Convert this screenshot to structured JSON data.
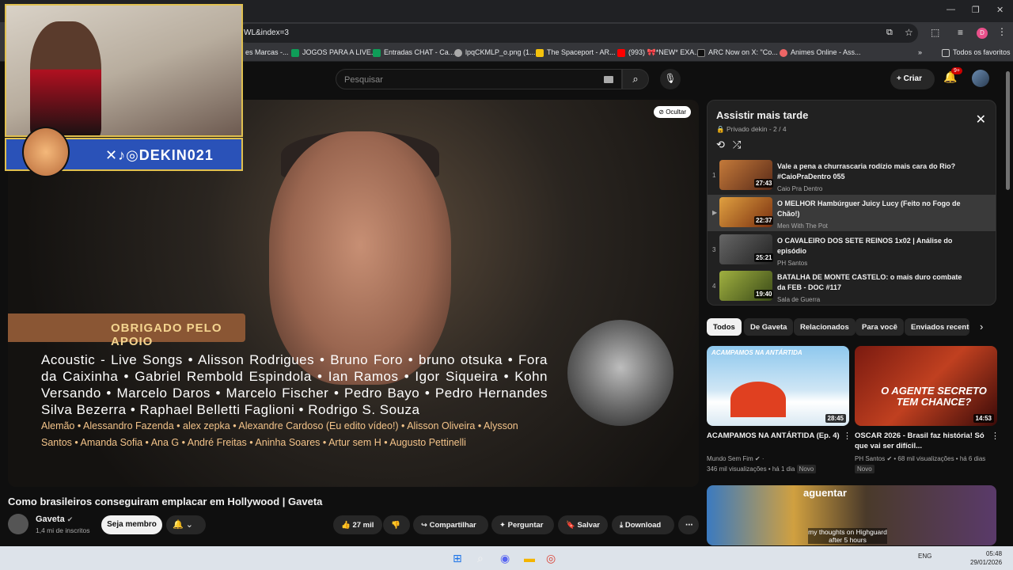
{
  "browser": {
    "url_fragment": "WL&index=3",
    "bookmarks": [
      {
        "label": "es Marcas -...",
        "color": "#888"
      },
      {
        "label": "JOGOS PARA A LIVE...",
        "color": "#0f9d58"
      },
      {
        "label": "Entradas CHAT - Ca...",
        "color": "#0f9d58"
      },
      {
        "label": "lpqCKMLP_o.png (1...",
        "color": "#aaa"
      },
      {
        "label": "The Spaceport - AR...",
        "color": "#f4c20d"
      },
      {
        "label": "(993) 🎀*NEW* EXA...",
        "color": "#ff0000"
      },
      {
        "label": "ARC Now on X: \"Co...",
        "color": "#111"
      },
      {
        "label": "Animes Online - Ass...",
        "color": "#e66"
      }
    ],
    "all_favorites": "Todos os favoritos"
  },
  "header": {
    "search_placeholder": "Pesquisar",
    "create_label": "Criar",
    "notif_badge": "9+"
  },
  "overlay": {
    "hide_label": "Ocultar",
    "social_handle": "DEKIN021",
    "thanks_label": "OBRIGADO PELO APOIO",
    "supporters_main": "Acoustic - Live Songs • Alisson Rodrigues • Bruno Foro • bruno otsuka • Fora da Caixinha • Gabriel Rembold Espindola • Ian Ramos • Igor Siqueira • Kohn Versando • Marcelo Daros • Marcelo Fischer • Pedro Bayo • Pedro Hernandes Silva Bezerra • Raphael Belletti Faglioni • Rodrigo S. Souza",
    "supporters_secondary": "Alemão • Alessandro Fazenda • alex zepka • Alexandre Cardoso (Eu edito vídeo!) • Alisson Oliveira • Alysson Santos • Amanda Sofia • Ana G • André Freitas • Aninha Soares • Artur sem H • Augusto Pettinelli"
  },
  "video": {
    "title": "Como brasileiros conseguiram emplacar em Hollywood | Gaveta",
    "channel": "Gaveta",
    "subscribers": "1,4 mi de inscritos",
    "join_label": "Seja membro",
    "likes": "27 mil",
    "share_label": "Compartilhar",
    "ask_label": "Perguntar",
    "save_label": "Salvar",
    "download_label": "Download"
  },
  "playlist": {
    "title": "Assistir mais tarde",
    "meta": "Privado  dekin - 2 / 4",
    "items": [
      {
        "num": "1",
        "title": "Vale a pena a churrascaria rodízio mais cara do Rio? #CaioPraDentro 055",
        "channel": "Caio Pra Dentro",
        "duration": "27:43",
        "color": "#a0522d"
      },
      {
        "num": "▶",
        "title": "O MELHOR Hambúrguer Juicy Lucy (Feito no Fogo de Chão!)",
        "channel": "Men With The Pot",
        "duration": "22:37",
        "color": "#c46a2a"
      },
      {
        "num": "3",
        "title": "O CAVALEIRO DOS SETE REINOS 1x02 | Análise do episódio",
        "channel": "PH Santos",
        "duration": "25:21",
        "color": "#4a4a4a"
      },
      {
        "num": "4",
        "title": "BATALHA DE MONTE CASTELO: o mais duro combate da FEB - DOC #117",
        "channel": "Sala de Guerra",
        "duration": "19:40",
        "color": "#6b7a2a"
      }
    ]
  },
  "chips": [
    "Todos",
    "De Gaveta",
    "Relacionados",
    "Para você",
    "Enviados recente"
  ],
  "recommended": [
    {
      "title": "ACAMPAMOS NA ANTÁRTIDA (Ep. 4)",
      "channel": "Mundo Sem Fim",
      "views": "346 mil visualizações",
      "age": "há 1 dia",
      "new": "Novo",
      "duration": "28:45",
      "overlay": "ACAMPAMOS NA ANTÁRTIDA"
    },
    {
      "title": "OSCAR 2026 - Brasil faz história! Só que vai ser difícil...",
      "channel": "PH Santos",
      "views": "68 mil visualizações",
      "age": "há 6 dias",
      "new": "Novo",
      "duration": "14:53",
      "overlay": "O AGENTE SECRETO TEM CHANCE?"
    }
  ],
  "rec_third_overlay": "my thoughts on Highguard after 5 hours",
  "rec_third_caption": "aguentar",
  "taskbar": {
    "lang": "ENG",
    "time": "05:48",
    "date": "29/01/2026"
  }
}
